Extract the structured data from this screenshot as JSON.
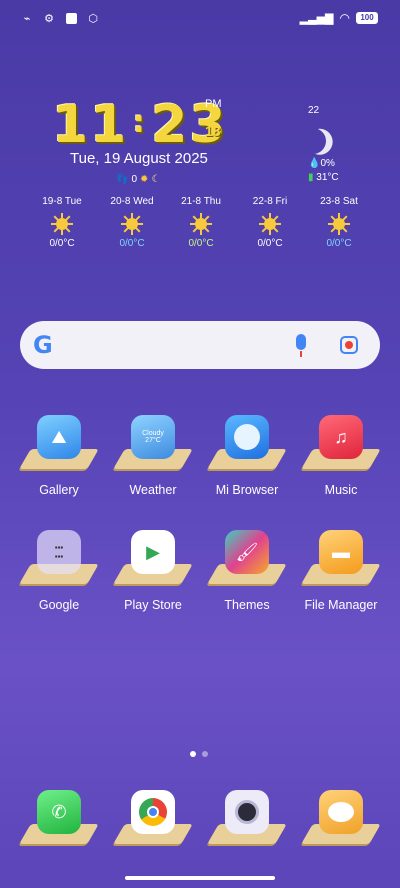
{
  "status_bar": {
    "left_icons": [
      "notification-off-icon",
      "gear-icon",
      "square-icon",
      "mi-icon"
    ],
    "battery": "100"
  },
  "clock": {
    "hours": "11",
    "colon": ":",
    "minutes": "23",
    "ampm": "PM",
    "seconds": "18"
  },
  "date": "Tue, 19 August 2025",
  "mini_status": {
    "steps": "0"
  },
  "weather_now": {
    "value": "22",
    "humidity": "0%",
    "temp": "31°C"
  },
  "forecast": [
    {
      "day": "19-8 Tue",
      "temp": "0/0°C",
      "color": "#ffffff"
    },
    {
      "day": "20-8 Wed",
      "temp": "0/0°C",
      "color": "#7fd6ff"
    },
    {
      "day": "21-8 Thu",
      "temp": "0/0°C",
      "color": "#c7f58a"
    },
    {
      "day": "22-8 Fri",
      "temp": "0/0°C",
      "color": "#ffffff"
    },
    {
      "day": "23-8 Sat",
      "temp": "0/0°C",
      "color": "#7fd6ff"
    }
  ],
  "search": {
    "logo": "G"
  },
  "apps_row1": [
    {
      "label": "Gallery",
      "icon": "gallery-icon",
      "color": "#3aa9f5"
    },
    {
      "label": "Weather",
      "icon": "weather-icon",
      "color": "#5ab6f5",
      "tile_text": "Cloudy",
      "tile_temp": "27°C"
    },
    {
      "label": "Mi Browser",
      "icon": "browser-icon",
      "color": "#2f8cf0"
    },
    {
      "label": "Music",
      "icon": "music-icon",
      "color": "#f0394f"
    }
  ],
  "apps_row2": [
    {
      "label": "Google",
      "icon": "google-folder-icon",
      "color": "#d9d3f2"
    },
    {
      "label": "Play Store",
      "icon": "play-store-icon",
      "color": "#ffffff"
    },
    {
      "label": "Themes",
      "icon": "themes-icon",
      "color": "#e0428f"
    },
    {
      "label": "File Manager",
      "icon": "file-manager-icon",
      "color": "#f7a928"
    }
  ],
  "dock": [
    {
      "icon": "phone-icon",
      "color": "#3fd15a"
    },
    {
      "icon": "chrome-icon",
      "color": "#ffffff"
    },
    {
      "icon": "camera-icon",
      "color": "#e8e6f6"
    },
    {
      "icon": "messages-icon",
      "color": "#f5b343"
    }
  ]
}
